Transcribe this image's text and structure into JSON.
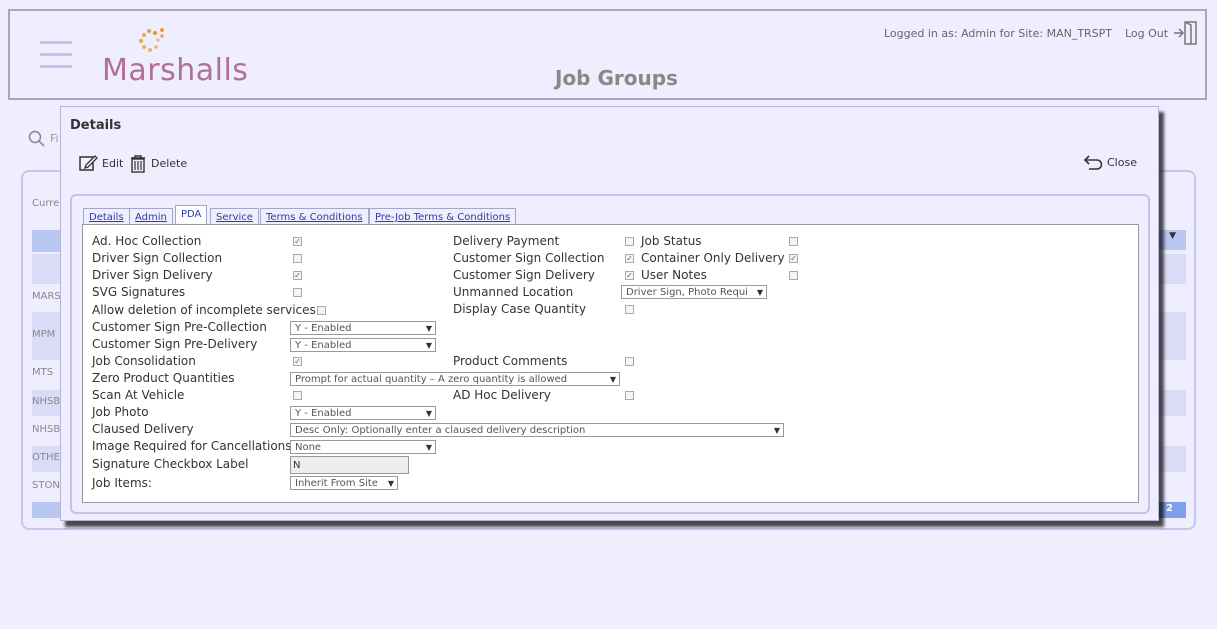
{
  "header": {
    "logo_text": "Marshalls",
    "page_title": "Job Groups",
    "logged_in": "Logged in as: Admin for Site: MAN_TRSPT",
    "logout_label": "Log Out"
  },
  "background": {
    "search_fragment": "Fi",
    "current_fragment": "Curre",
    "rows": [
      "MARS",
      "MPM",
      "MTS",
      "NHSB",
      "NHSB",
      "OTHE",
      "STON"
    ],
    "page_number": "2"
  },
  "modal": {
    "title": "Details",
    "edit_label": "Edit",
    "delete_label": "Delete",
    "close_label": "Close",
    "tabs": [
      "Details",
      "Admin",
      "PDA",
      "Service",
      "Terms & Conditions",
      "Pre-Job Terms & Conditions"
    ],
    "active_tab": "PDA"
  },
  "pda": {
    "left": [
      {
        "label": "Ad. Hoc Collection",
        "checked": true
      },
      {
        "label": "Driver Sign Collection",
        "checked": false
      },
      {
        "label": "Driver Sign Delivery",
        "checked": true
      },
      {
        "label": "SVG Signatures",
        "checked": false
      },
      {
        "label": "Allow deletion of incomplete services",
        "checked": false
      },
      {
        "label": "Customer Sign Pre-Collection",
        "select": "Y - Enabled"
      },
      {
        "label": "Customer Sign Pre-Delivery",
        "select": "Y - Enabled"
      },
      {
        "label": "Job Consolidation",
        "checked": true
      },
      {
        "label": "Zero Product Quantities",
        "select": "Prompt for actual quantity – A zero quantity is allowed"
      },
      {
        "label": "Scan At Vehicle",
        "checked": false
      },
      {
        "label": "Job Photo",
        "select": "Y - Enabled"
      },
      {
        "label": "Claused Delivery",
        "select": "Desc Only: Optionally enter a claused delivery description"
      },
      {
        "label": "Image Required for Cancellations",
        "select": "None"
      },
      {
        "label": "Signature Checkbox Label",
        "input": "N"
      },
      {
        "label": "Job Items:",
        "select": "Inherit From Site"
      }
    ],
    "middle": [
      {
        "label": "Delivery Payment",
        "checked": false
      },
      {
        "label": "Customer Sign Collection",
        "checked": true
      },
      {
        "label": "Customer Sign Delivery",
        "checked": true
      },
      {
        "label": "Unmanned Location",
        "select": "Driver Sign, Photo Requi"
      },
      {
        "label": "Display Case Quantity",
        "checked": false
      },
      {
        "label": "Product Comments",
        "checked": false
      },
      {
        "label": "AD Hoc Delivery",
        "checked": false
      }
    ],
    "right": [
      {
        "label": "Job Status",
        "checked": false
      },
      {
        "label": "Container Only Delivery",
        "checked": true
      },
      {
        "label": "User Notes",
        "checked": false
      }
    ]
  }
}
